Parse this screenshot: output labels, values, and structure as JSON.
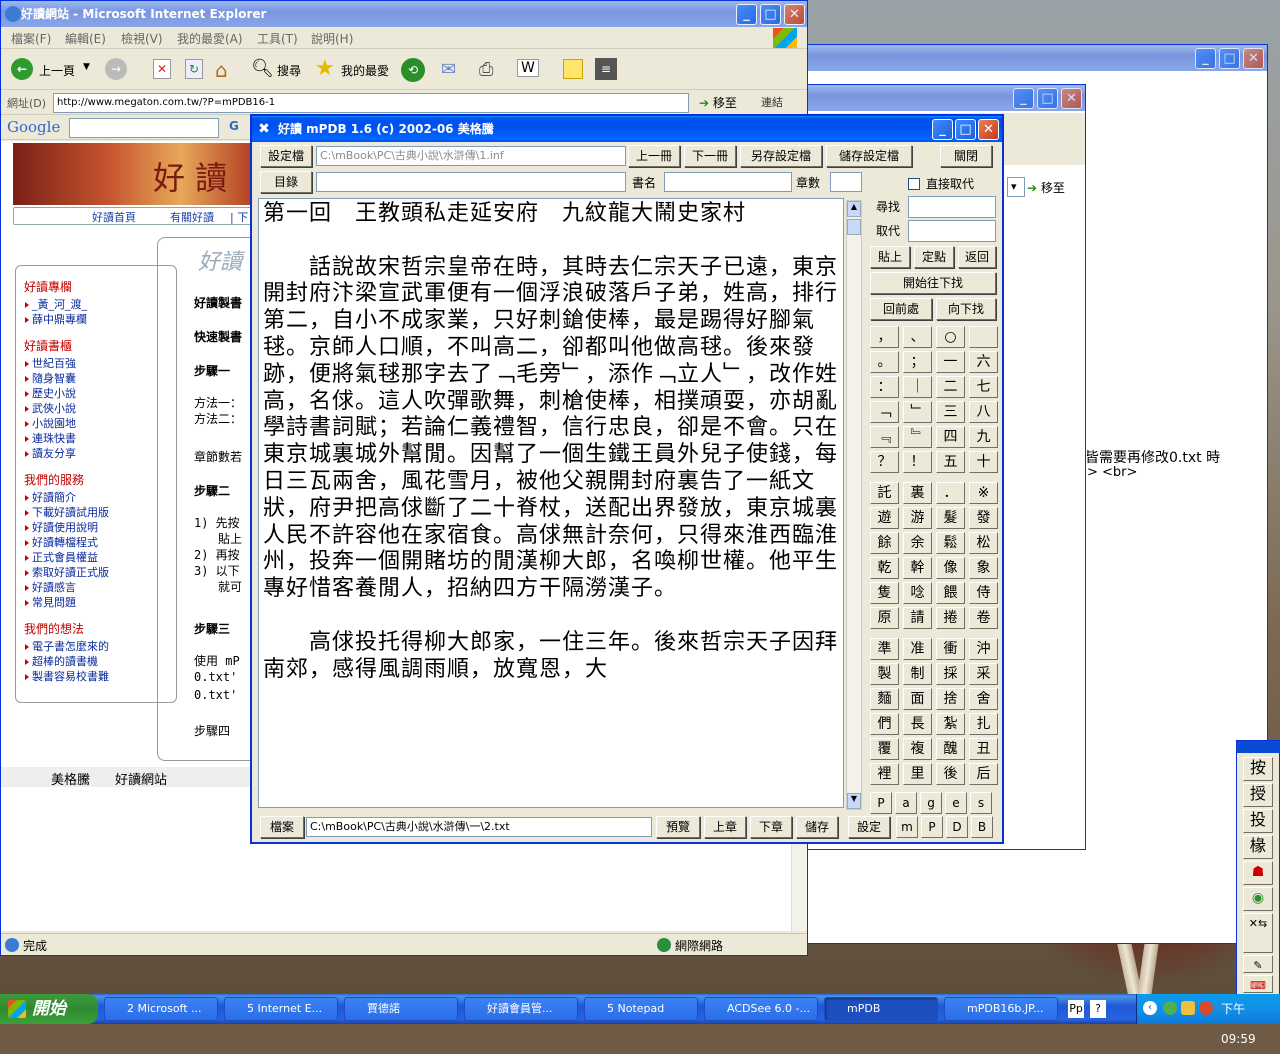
{
  "ie": {
    "title": "好讀網站 - Microsoft Internet Explorer",
    "menu": [
      "檔案(F)",
      "編輯(E)",
      "檢視(V)",
      "我的最愛(A)",
      "工具(T)",
      "說明(H)"
    ],
    "toolbar": {
      "back": "上一頁",
      "search": "搜尋",
      "favorites": "我的最愛"
    },
    "address_label": "網址(D)",
    "address": "http://www.megaton.com.tw/?P=mPDB16-1",
    "go": "移至",
    "links": "連結",
    "google": "Google",
    "nav": [
      "好讀首頁",
      "有關好讀",
      "下"
    ],
    "logo_text": "好 讀",
    "side": [
      {
        "title": "好讀專欄",
        "items": [
          "_黃_河_渡_",
          "薛中鼎專欄"
        ]
      },
      {
        "title": "好讀書櫃",
        "items": [
          "世紀百強",
          "隨身智囊",
          "歷史小說",
          "武俠小說",
          "小說園地",
          "連珠快書",
          "讀友分享"
        ]
      },
      {
        "title": "我們的服務",
        "items": [
          "好讀簡介",
          "下載好讀試用版",
          "好讀使用說明",
          "好讀轉檔程式",
          "正式會員權益",
          "索取好讀正式版",
          "好讀感言",
          "常見問題"
        ]
      },
      {
        "title": "我們的想法",
        "items": [
          "電子書怎麼來的",
          "超棒的讀書機",
          "製書容易校書難"
        ]
      }
    ],
    "main_heading": "好讀",
    "main_lines": [
      "好讀製書",
      "快速製書",
      "步驟一",
      "方法一：",
      "方法二：",
      "章節數若",
      "步驟二",
      "1) 先按",
      "貼上",
      "2) 再按",
      "3) 以下",
      "就可",
      "步驟三",
      "使用 mP",
      "0.txt'",
      "0.txt'",
      "步驟四"
    ],
    "footer": [
      "美格騰",
      "好讀網站"
    ],
    "status": "完成",
    "zone": "網際網路"
  },
  "bg_window": {
    "go": "移至",
    "text1": "皆需要再修改0.txt 時",
    "text2": "> <br>"
  },
  "mpdb": {
    "title": "好讀 mPDB 1.6 (c) 2002-06 美格騰",
    "settings_btn": "設定檔",
    "settings_path": "C:\\mBook\\PC\\古典小說\\水滸傳\\1.inf",
    "prev_book": "上一冊",
    "next_book": "下一冊",
    "save_as": "另存設定檔",
    "save_settings": "儲存設定檔",
    "close": "關閉",
    "toc_btn": "目錄",
    "book_name_label": "書名",
    "chapters_label": "章數",
    "direct_replace": "直接取代",
    "find_label": "尋找",
    "replace_label": "取代",
    "paste": "貼上",
    "fix_point": "定點",
    "back": "返回",
    "start_find": "開始往下找",
    "prev_find": "回前處",
    "next_find": "向下找",
    "glyphs": [
      "，",
      "、",
      "○",
      "",
      "。",
      "；",
      "一",
      "六",
      "：",
      "｜",
      "二",
      "七",
      "﹁",
      "﹂",
      "三",
      "八",
      "﹃",
      "﹄",
      "四",
      "九",
      "？",
      "！",
      "五",
      "十",
      "託",
      "裏",
      "．",
      "※",
      "遊",
      "游",
      "髮",
      "發",
      "餘",
      "余",
      "鬆",
      "松",
      "乾",
      "幹",
      "像",
      "象",
      "隻",
      "唸",
      "餵",
      "侍",
      "原",
      "請",
      "捲",
      "卷",
      "準",
      "准",
      "衝",
      "沖",
      "製",
      "制",
      "採",
      "采",
      "麵",
      "面",
      "捨",
      "舍",
      "們",
      "長",
      "紮",
      "扎",
      "覆",
      "複",
      "醜",
      "丑",
      "裡",
      "里",
      "後",
      "后"
    ],
    "mode_keys": [
      "P",
      "a",
      "g",
      "e",
      "s"
    ],
    "file_btn": "檔案",
    "file_path": "C:\\mBook\\PC\\古典小說\\水滸傳\\一\\2.txt",
    "preview": "預覽",
    "prev_ch": "上章",
    "next_ch": "下章",
    "save": "儲存",
    "setup": "設定",
    "small_keys": [
      "m",
      "P",
      "D",
      "B"
    ],
    "text": "第一回　王教頭私走延安府　九紋龍大鬧史家村\n\n　　話說故宋哲宗皇帝在時，其時去仁宗天子已遠，東京開封府汴梁宣武軍便有一個浮浪破落戶子弟，姓高，排行第二，自小不成家業，只好刺鎗使棒，最是踢得好腳氣毬。京師人口順，不叫高二，卻都叫他做高毬。後來發跡，便將氣毬那字去了﹁毛旁﹂，添作﹁立人﹂，改作姓高，名俅。這人吹彈歌舞，刺槍使棒，相撲頑耍，亦胡亂學詩書詞賦；若論仁義禮智，信行忠良，卻是不會。只在東京城裏城外幫閒。因幫了一個生鐵王員外兒子使錢，每日三瓦兩舍，風花雪月，被他父親開封府裏告了一紙文狀，府尹把高俅斷了二十脊杖，送配出界發放，東京城裏人民不許容他在家宿食。高俅無計奈何，只得來淮西臨淮州，投奔一個開賭坊的閒漢柳大郎，名喚柳世權。他平生專好惜客養閒人，招納四方干隔澇漢子。\n\n　　高俅投托得柳大郎家，一住三年。後來哲宗天子因拜南郊，感得風調雨順，放寬恩，大"
  },
  "floating_bar": [
    "按",
    "授",
    "投",
    "椽"
  ],
  "taskbar": {
    "start": "開始",
    "tasks": [
      "2 Microsoft ...",
      "5 Internet E...",
      "賈德諾",
      "好讀會員管...",
      "5 Notepad",
      "ACDSee 6.0 -...",
      "mPDB",
      "mPDB16b.JP..."
    ],
    "clock": "下午 09:59"
  }
}
